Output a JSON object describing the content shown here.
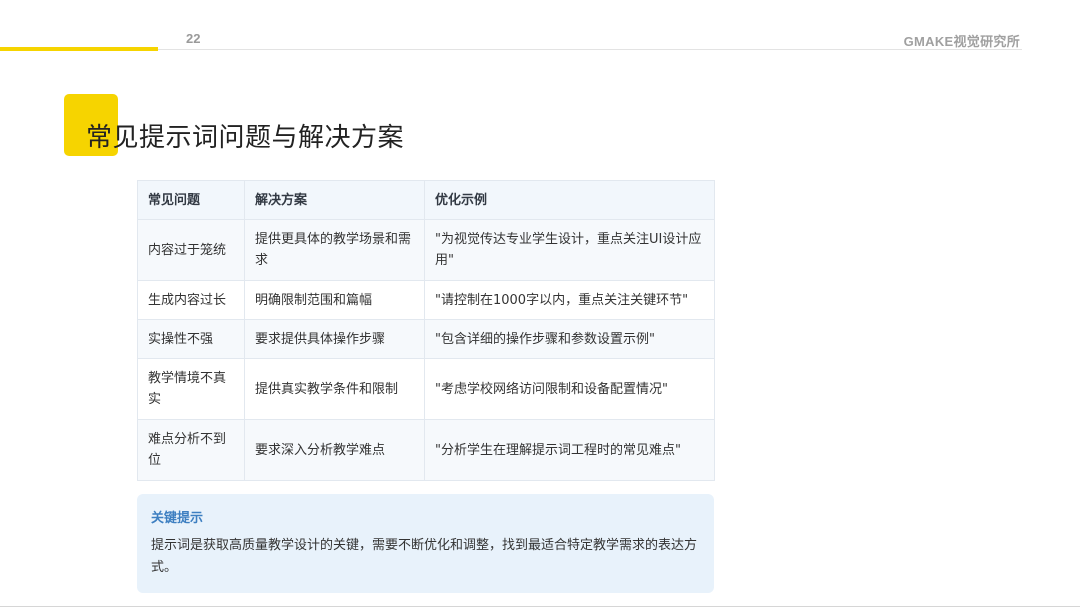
{
  "header": {
    "page_number": "22",
    "brand": "GMAKE视觉研究所"
  },
  "slide": {
    "title": "常见提示词问题与解决方案"
  },
  "table": {
    "columns": [
      "常见问题",
      "解决方案",
      "优化示例"
    ],
    "rows": [
      {
        "problem": "内容过于笼统",
        "solution": "提供更具体的教学场景和需求",
        "example": "\"为视觉传达专业学生设计，重点关注UI设计应用\""
      },
      {
        "problem": "生成内容过长",
        "solution": "明确限制范围和篇幅",
        "example": "\"请控制在1000字以内，重点关注关键环节\""
      },
      {
        "problem": "实操性不强",
        "solution": "要求提供具体操作步骤",
        "example": "\"包含详细的操作步骤和参数设置示例\""
      },
      {
        "problem": "教学情境不真实",
        "solution": "提供真实教学条件和限制",
        "example": "\"考虑学校网络访问限制和设备配置情况\""
      },
      {
        "problem": "难点分析不到位",
        "solution": "要求深入分析教学难点",
        "example": "\"分析学生在理解提示词工程时的常见难点\""
      }
    ]
  },
  "tip": {
    "title": "关键提示",
    "text": "提示词是获取高质量教学设计的关键，需要不断优化和调整，找到最适合特定教学需求的表达方式。"
  },
  "colors": {
    "accent_yellow": "#f6d400",
    "tip_title_blue": "#3d7fc1",
    "tip_background": "#e8f2fb",
    "table_header_background": "#f2f7fc"
  }
}
